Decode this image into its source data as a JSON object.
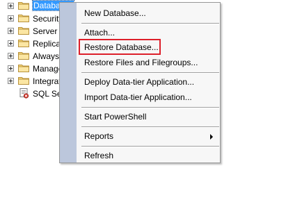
{
  "object_explorer": {
    "nodes": [
      {
        "label": "Databases",
        "icon": "folder-icon",
        "selected": true
      },
      {
        "label": "Security",
        "icon": "folder-icon",
        "selected": false
      },
      {
        "label": "Server Objects",
        "icon": "folder-icon",
        "selected": false
      },
      {
        "label": "Replication",
        "icon": "folder-icon",
        "selected": false
      },
      {
        "label": "AlwaysOn High Availability",
        "icon": "folder-icon",
        "selected": false
      },
      {
        "label": "Management",
        "icon": "folder-icon",
        "selected": false
      },
      {
        "label": "Integration Services Catalogs",
        "icon": "folder-icon",
        "selected": false
      },
      {
        "label": "SQL Server Agent",
        "icon": "sql-agent-icon",
        "selected": false
      }
    ]
  },
  "context_menu": {
    "items": [
      {
        "label": "New Database..."
      },
      {
        "label": "Attach..."
      },
      {
        "label": "Restore Database..."
      },
      {
        "label": "Restore Files and Filegroups..."
      },
      {
        "label": "Deploy Data-tier Application..."
      },
      {
        "label": "Import Data-tier Application..."
      },
      {
        "label": "Start PowerShell"
      },
      {
        "label": "Reports",
        "has_submenu": true
      },
      {
        "label": "Refresh"
      }
    ],
    "highlighted_item": "Restore Database..."
  },
  "colors": {
    "selection_bg": "#3399ff",
    "highlight_border": "#dd1f2a",
    "menu_gutter": "#bcc7dc",
    "menu_bg": "#f7f7f7",
    "folder_yellow": "#f5d67b"
  }
}
